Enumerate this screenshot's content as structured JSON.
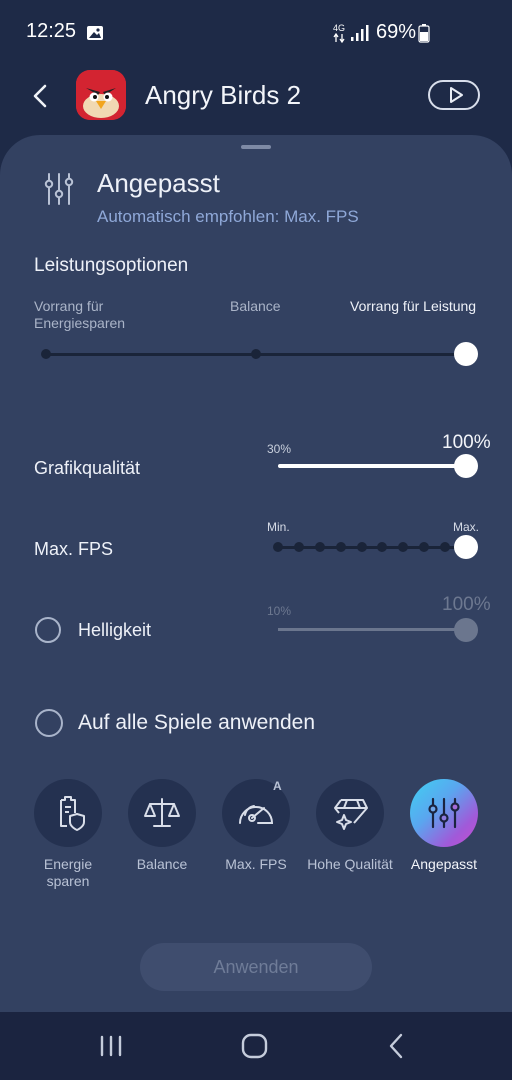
{
  "status_bar": {
    "time": "12:25",
    "network": "4G",
    "battery": "69%"
  },
  "header": {
    "app_name": "Angry Birds 2"
  },
  "profile": {
    "title": "Angepasst",
    "subtitle": "Automatisch empfohlen: Max. FPS"
  },
  "performance": {
    "section_title": "Leistungsoptionen",
    "options": [
      "Vorrang für Energiesparen",
      "Balance",
      "Vorrang für Leistung"
    ],
    "selected_index": 2
  },
  "graphics": {
    "label": "Grafikqualität",
    "min_label": "30%",
    "value_label": "100%",
    "level": 1.0
  },
  "fps": {
    "label": "Max. FPS",
    "min_label": "Min.",
    "max_label": "Max.",
    "step_count": 10,
    "selected_step": 10
  },
  "brightness": {
    "label": "Helligkeit",
    "min_label": "10%",
    "value_label": "100%",
    "enabled": false
  },
  "apply_all": {
    "label": "Auf alle Spiele anwenden",
    "checked": false
  },
  "modes": [
    {
      "label": "Energie sparen",
      "icon": "battery-shield-icon",
      "active": false
    },
    {
      "label": "Balance",
      "icon": "scale-icon",
      "active": false
    },
    {
      "label": "Max. FPS",
      "icon": "speedometer-icon",
      "active": false,
      "badge": "A"
    },
    {
      "label": "Hohe Qualität",
      "icon": "diamond-icon",
      "active": false
    },
    {
      "label": "Angepasst",
      "icon": "sliders-icon",
      "active": true
    }
  ],
  "apply_button": "Anwenden",
  "colors": {
    "background": "#1e2a47",
    "sheet": "#334161",
    "accent_text": "#8fa8d8"
  }
}
